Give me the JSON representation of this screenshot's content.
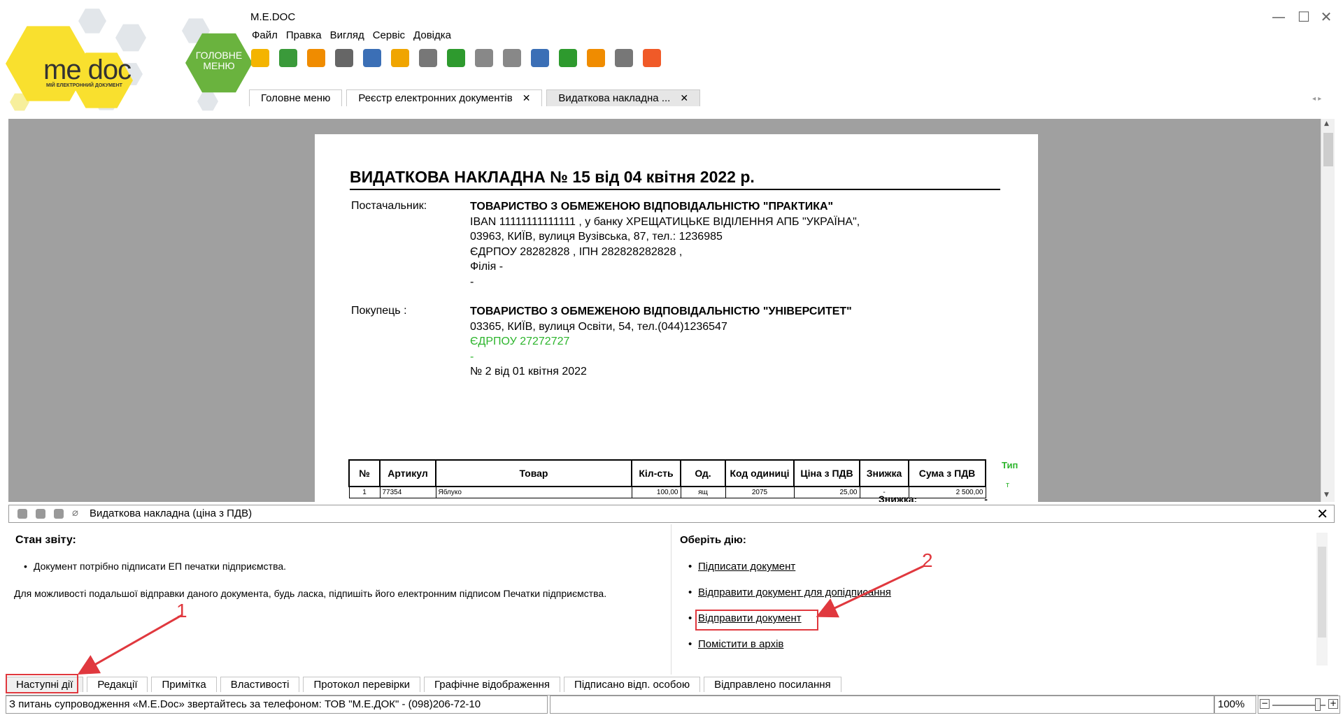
{
  "brand": {
    "logo": "me doc",
    "logo_sub": "МІЙ ЕЛЕКТРОННИЙ ДОКУМЕНТ",
    "home_label": "ГОЛОВНЕ МЕНЮ",
    "colors": {
      "yellow": "#f9e02e",
      "green": "#6ab33e",
      "hex_grey": "#e2e6ea",
      "annotation_red": "#e0383e"
    }
  },
  "window": {
    "title": "M.E.DOC",
    "controls": [
      "—",
      "☐",
      "✕"
    ]
  },
  "menu": [
    "Файл",
    "Правка",
    "Вигляд",
    "Сервіс",
    "Довідка"
  ],
  "toolbar": [
    {
      "icon": "new-document-icon",
      "color": "#f4b400"
    },
    {
      "icon": "copy-document-icon",
      "color": "#3a9a3a"
    },
    {
      "icon": "send-envelope-icon",
      "color": "#f08c00"
    },
    {
      "icon": "archive-box-icon",
      "color": "#666666"
    },
    {
      "icon": "print-icon",
      "color": "#3b6fb6"
    },
    {
      "icon": "mail-icon",
      "color": "#f0a500"
    },
    {
      "icon": "sign-seal-icon",
      "color": "#777777"
    },
    {
      "icon": "checklist-icon",
      "color": "#2e9a2e"
    },
    {
      "icon": "refresh-icon",
      "color": "#888888"
    },
    {
      "icon": "inbox-icon",
      "color": "#888888"
    },
    {
      "icon": "preview-search-icon",
      "color": "#3b6fb6"
    },
    {
      "icon": "download-icon",
      "color": "#2e9a2e"
    },
    {
      "icon": "help-icon",
      "color": "#f08c00"
    },
    {
      "icon": "chat-icon",
      "color": "#777777"
    },
    {
      "icon": "comment-icon",
      "color": "#f05a28"
    }
  ],
  "tabs": [
    {
      "label": "Головне меню",
      "closable": false
    },
    {
      "label": "Реєстр електронних документів",
      "closable": true
    },
    {
      "label": "Видаткова накладна ...",
      "closable": true,
      "active": true
    }
  ],
  "tab_close": "✕",
  "tab_nav": "◂ ▸",
  "document": {
    "title": "ВИДАТКОВА НАКЛАДНА  №  15 від 04 квітня 2022 р.",
    "supplier_label": "Постачальник:",
    "supplier": [
      "ТОВАРИСТВО З ОБМЕЖЕНОЮ ВІДПОВІДАЛЬНІСТЮ \"ПРАКТИКА\"",
      "IBAN 11111111111111 , у банку ХРЕЩАТИЦЬКЕ ВІДІЛЕННЯ АПБ \"УКРАЇНА\",",
      "03963, КИЇВ, вулиця Вузівська, 87, тел.: 1236985",
      "ЄДРПОУ 28282828 , ІПН 282828282828 ,",
      "Філія -",
      "-"
    ],
    "buyer_label": "Покупець :",
    "buyer": [
      "ТОВАРИСТВО З ОБМЕЖЕНОЮ ВІДПОВІДАЛЬНІСТЮ \"УНІВЕРСИТЕТ\"",
      "03365, КИЇВ, вулиця Освіти, 54, тел.(044)1236547",
      "ЄДРПОУ 27272727",
      "-",
      "№ 2 від 01 квітня 2022"
    ],
    "table": {
      "headers": [
        "№",
        "Артикул",
        "Товар",
        "Кіл-сть",
        "Од.",
        "Код одиниці",
        "Ціна з ПДВ",
        "Знижка",
        "Сума з ПДВ"
      ],
      "rows": [
        [
          "1",
          "77354",
          "Яблуко",
          "100,00",
          "ящ",
          "2075",
          "25,00",
          "-",
          "2 500,00"
        ]
      ]
    },
    "type_label": "Тип",
    "type_value": "т",
    "discount_label": "Знижка:",
    "discount_value": "-"
  },
  "panel": {
    "title": "Видаткова накладна (ціна з ПДВ)",
    "close": "✕",
    "status_heading": "Стан звіту:",
    "status_bullet": "Документ потрібно підписати ЕП печатки підприємства.",
    "status_note": "Для можливості подальшої відправки даного документа, будь ласка, підпишіть його електронним підписом Печатки підприємства.",
    "actions_heading": "Оберіть дію:",
    "actions": [
      "Підписати документ",
      "Відправити документ для допідписання",
      "Відправити документ",
      "Помістити в архів"
    ]
  },
  "bottom_tabs": [
    "Наступні дії",
    "Редакції",
    "Примітка",
    "Властивості",
    "Протокол перевірки",
    "Графічне відображення",
    "Підписано відп. особою",
    "Відправлено посилання"
  ],
  "status": {
    "text": "З питань супроводження «M.E.Doc» звертайтесь за телефоном: ТОВ \"М.Е.ДОК\" - (098)206-72-10",
    "zoom": "100%",
    "zoom_fraction": 0.85
  },
  "annotations": [
    "1",
    "2"
  ]
}
